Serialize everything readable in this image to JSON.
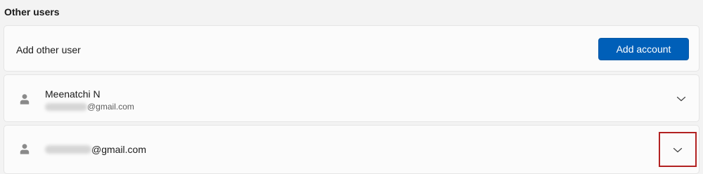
{
  "section": {
    "title": "Other users"
  },
  "add_user": {
    "label": "Add other user",
    "button_label": "Add account",
    "button_color": "#005fb8"
  },
  "users": [
    {
      "name": "Meenatchi N",
      "email_suffix": "@gmail.com",
      "email_prefix_redacted": true,
      "icon": "person-icon",
      "expand_icon": "chevron-down-icon"
    },
    {
      "email_suffix": "@gmail.com",
      "email_prefix_redacted": true,
      "icon": "person-icon",
      "expand_icon": "chevron-down-icon",
      "highlighted": true,
      "highlight_color": "#b22121"
    }
  ]
}
